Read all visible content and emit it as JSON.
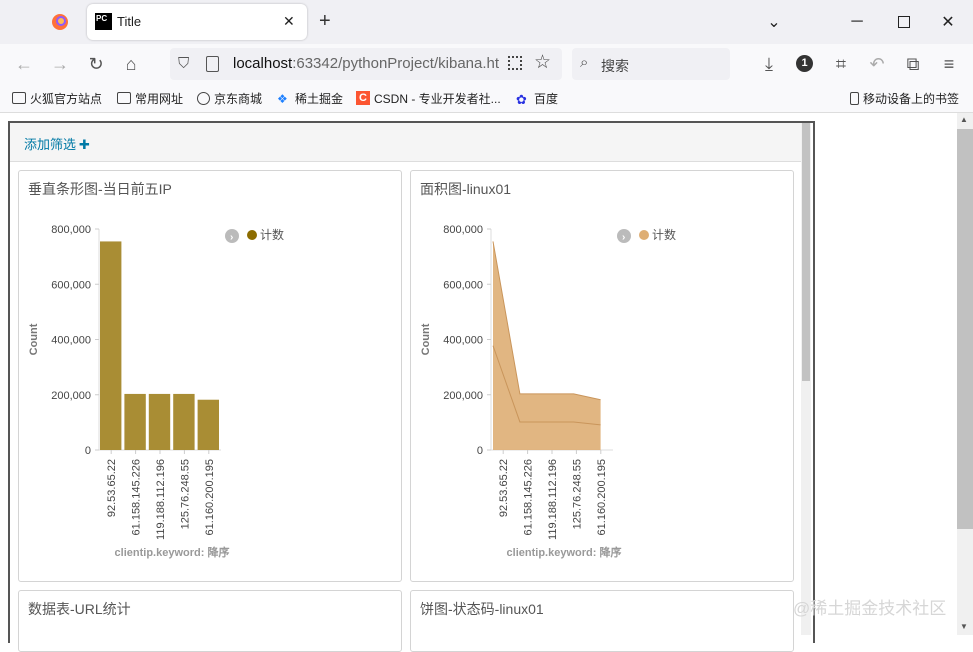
{
  "browser": {
    "tab_title": "Title",
    "url_host": "localhost",
    "url_rest": ":63342/pythonProject/kibana.ht",
    "search_placeholder": "搜索",
    "badge_count": "1"
  },
  "bookmarks": [
    {
      "label": "火狐官方站点",
      "icon": "folder-icon"
    },
    {
      "label": "常用网址",
      "icon": "folder-icon"
    },
    {
      "label": "京东商城",
      "icon": "globe-icon"
    },
    {
      "label": "稀土掘金",
      "icon": "juejin-icon"
    },
    {
      "label": "CSDN - 专业开发者社...",
      "icon": "csdn-icon"
    },
    {
      "label": "百度",
      "icon": "baidu-icon"
    }
  ],
  "mobile_bookmarks": "移动设备上的书签",
  "filter": {
    "add_label": "添加筛选"
  },
  "panels": {
    "bar_title": "垂直条形图-当日前五IP",
    "area_title": "面积图-linux01",
    "table_title": "数据表-URL统计",
    "pie_title": "饼图-状态码-linux01"
  },
  "watermark": "@稀土掘金技术社区",
  "colors": {
    "bar": "#a98d34",
    "area": "#deae74",
    "area_line": "#c9955b",
    "link": "#0079a5"
  },
  "chart_data": [
    {
      "type": "bar",
      "categories": [
        "92.53.65.22",
        "61.158.145.226",
        "119.188.112.196",
        "125.76.248.55",
        "61.160.200.195"
      ],
      "values": [
        755000,
        203000,
        203000,
        203000,
        182000
      ],
      "title": "",
      "xlabel": "clientip.keyword: 降序",
      "ylabel": "Count",
      "ylim": [
        0,
        800000
      ],
      "yticks": [
        "800,000",
        "600,000",
        "400,000",
        "200,000",
        "0"
      ],
      "legend": [
        "计数"
      ],
      "legend_position": "top-right"
    },
    {
      "type": "area",
      "categories": [
        "92.53.65.22",
        "61.158.145.226",
        "119.188.112.196",
        "125.76.248.55",
        "61.160.200.195"
      ],
      "values": [
        755000,
        203000,
        203000,
        203000,
        182000
      ],
      "title": "",
      "xlabel": "clientip.keyword: 降序",
      "ylabel": "Count",
      "ylim": [
        0,
        800000
      ],
      "yticks": [
        "800,000",
        "600,000",
        "400,000",
        "200,000",
        "0"
      ],
      "legend": [
        "计数"
      ],
      "legend_position": "top-right"
    }
  ]
}
